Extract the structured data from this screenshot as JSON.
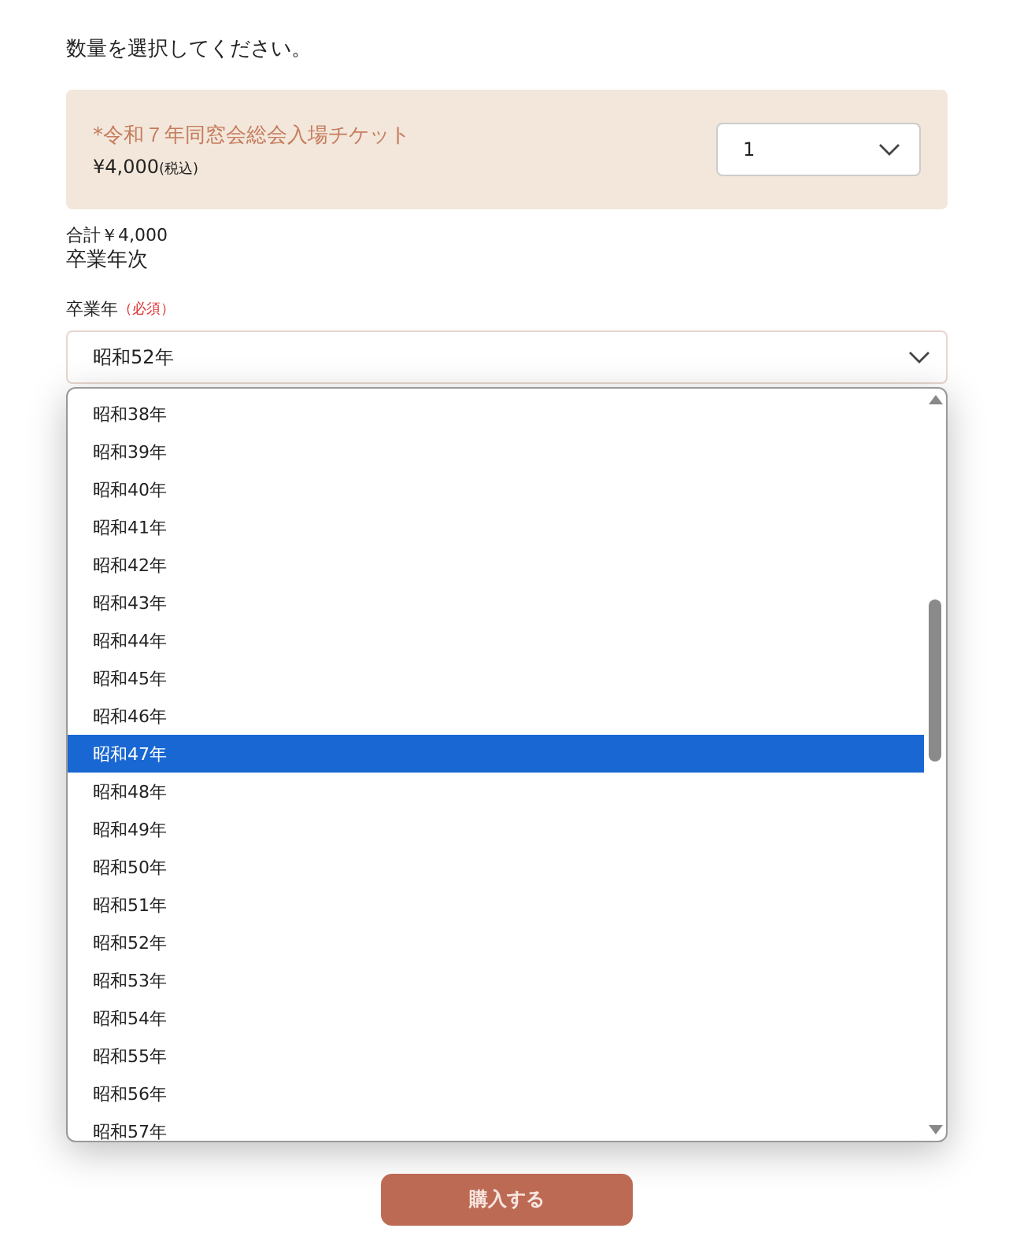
{
  "instruction": "数量を選択してください。",
  "ticket": {
    "name": "*令和７年同窓会総会入場チケット",
    "price": "¥4,000",
    "tax_note": "(税込)",
    "quantity": "1"
  },
  "total": "合計￥4,000",
  "section_title": "卒業年次",
  "field": {
    "label": "卒業年",
    "required": "（必須）",
    "value": "昭和52年"
  },
  "options": [
    {
      "label": "昭和38年",
      "selected": false
    },
    {
      "label": "昭和39年",
      "selected": false
    },
    {
      "label": "昭和40年",
      "selected": false
    },
    {
      "label": "昭和41年",
      "selected": false
    },
    {
      "label": "昭和42年",
      "selected": false
    },
    {
      "label": "昭和43年",
      "selected": false
    },
    {
      "label": "昭和44年",
      "selected": false
    },
    {
      "label": "昭和45年",
      "selected": false
    },
    {
      "label": "昭和46年",
      "selected": false
    },
    {
      "label": "昭和47年",
      "selected": true
    },
    {
      "label": "昭和48年",
      "selected": false
    },
    {
      "label": "昭和49年",
      "selected": false
    },
    {
      "label": "昭和50年",
      "selected": false
    },
    {
      "label": "昭和51年",
      "selected": false
    },
    {
      "label": "昭和52年",
      "selected": false
    },
    {
      "label": "昭和53年",
      "selected": false
    },
    {
      "label": "昭和54年",
      "selected": false
    },
    {
      "label": "昭和55年",
      "selected": false
    },
    {
      "label": "昭和56年",
      "selected": false
    },
    {
      "label": "昭和57年",
      "selected": false
    }
  ],
  "submit": "購入する"
}
